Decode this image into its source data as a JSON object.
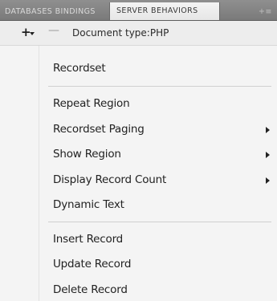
{
  "tabs": [
    {
      "label": "DATABASES BINDINGS"
    },
    {
      "label": "SERVER BEHAVIORS"
    },
    {
      "label": "+≡"
    }
  ],
  "toolbar": {
    "plus_glyph": "+",
    "minus_glyph": "—",
    "doc_type": "Document type:PHP"
  },
  "menu": {
    "recordset": "Recordset",
    "repeat_region": "Repeat Region",
    "recordset_paging": "Recordset Paging",
    "show_region": "Show Region",
    "display_record_count": "Display Record Count",
    "dynamic_text": "Dynamic Text",
    "insert_record": "Insert Record",
    "update_record": "Update Record",
    "delete_record": "Delete Record"
  },
  "icons": {
    "add": "plus-icon",
    "remove": "minus-icon",
    "submenu": "submenu-arrow-icon"
  }
}
